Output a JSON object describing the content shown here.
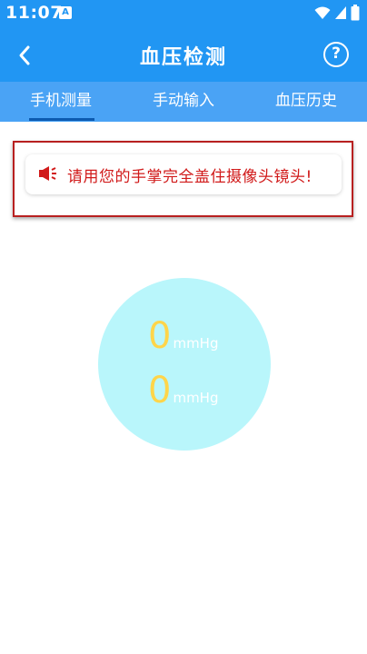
{
  "status_bar": {
    "time": "11:07",
    "notification_letter": "A"
  },
  "app_bar": {
    "title": "血压检测"
  },
  "tabs": [
    {
      "label": "手机测量",
      "active": true
    },
    {
      "label": "手动输入",
      "active": false
    },
    {
      "label": "血压历史",
      "active": false
    }
  ],
  "tip": {
    "text": "请用您的手掌完全盖住摄像头镜头!"
  },
  "readings": [
    {
      "value": "0",
      "unit": "mmHg"
    },
    {
      "value": "0",
      "unit": "mmHg"
    }
  ],
  "colors": {
    "primary": "#2196f3",
    "tab_bar": "#4aa3f5",
    "tip_text": "#d11a1a",
    "gauge_fill": "#b9f6fb",
    "reading_value": "#ffd54a"
  },
  "icons": [
    "back-arrow-icon",
    "help-icon",
    "speaker-icon",
    "wifi-icon",
    "signal-icon",
    "battery-icon"
  ]
}
